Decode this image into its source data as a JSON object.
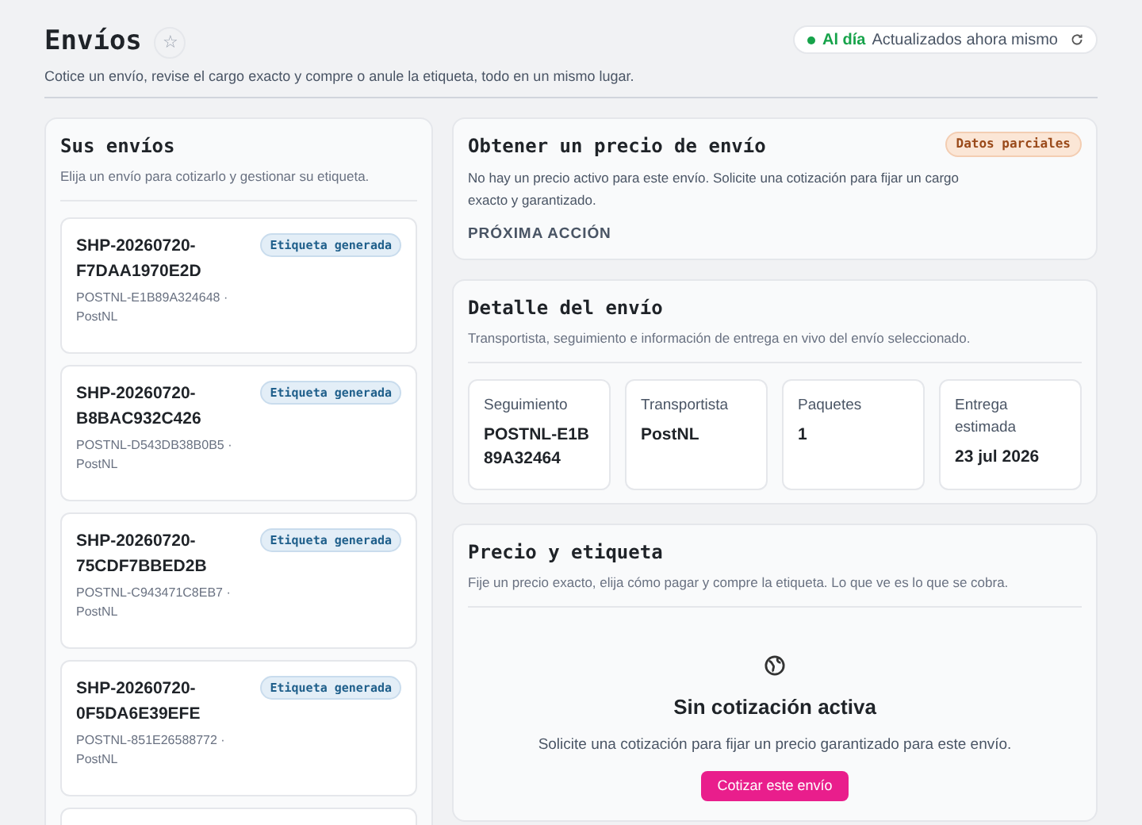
{
  "header": {
    "title": "Envíos",
    "favorite_icon": "☆",
    "subtitle": "Cotice un envío, revise el cargo exacto y compre o anule la etiqueta, todo en un mismo lugar.",
    "status": {
      "label": "Al día",
      "text": "Actualizados ahora mismo",
      "color": "#16a34a"
    }
  },
  "shipments_panel": {
    "title": "Sus envíos",
    "subtitle": "Elija un envío para cotizarlo y gestionar su etiqueta.",
    "items": [
      {
        "id": "SHP-20260720-F7DAA1970E2D",
        "tracking": "POSTNL-E1B89A324648 ·",
        "carrier": "PostNL",
        "badge": "Etiqueta generada"
      },
      {
        "id": "SHP-20260720-B8BAC932C426",
        "tracking": "POSTNL-D543DB38B0B5 ·",
        "carrier": "PostNL",
        "badge": "Etiqueta generada"
      },
      {
        "id": "SHP-20260720-75CDF7BBED2B",
        "tracking": "POSTNL-C943471C8EB7 ·",
        "carrier": "PostNL",
        "badge": "Etiqueta generada"
      },
      {
        "id": "SHP-20260720-0F5DA6E39EFE",
        "tracking": "POSTNL-851E26588772 ·",
        "carrier": "PostNL",
        "badge": "Etiqueta generada"
      }
    ],
    "more_items": true
  },
  "quote_panel": {
    "title": "Obtener un precio de envío",
    "badge": "Datos parciales",
    "text": "No hay un precio activo para este envío. Solicite una cotización para fijar un cargo exacto y garantizado.",
    "next_action": "PRÓXIMA ACCIÓN"
  },
  "detail_panel": {
    "title": "Detalle del envío",
    "subtitle": "Transportista, seguimiento e información de entrega en vivo del envío seleccionado.",
    "stats": [
      {
        "label": "Seguimiento",
        "value": "POSTNL-E1B89A32464"
      },
      {
        "label": "Transportista",
        "value": "PostNL"
      },
      {
        "label": "Paquetes",
        "value": "1"
      },
      {
        "label": "Entrega estimada",
        "value": "23 jul 2026"
      }
    ]
  },
  "label_panel": {
    "title": "Precio y etiqueta",
    "subtitle": "Fije un precio exacto, elija cómo pagar y compre la etiqueta. Lo que ve es lo que se cobra.",
    "empty_title": "Sin cotización activa",
    "empty_text": "Solicite una cotización para fijar un precio garantizado para este envío.",
    "button": "Cotizar este envío"
  }
}
